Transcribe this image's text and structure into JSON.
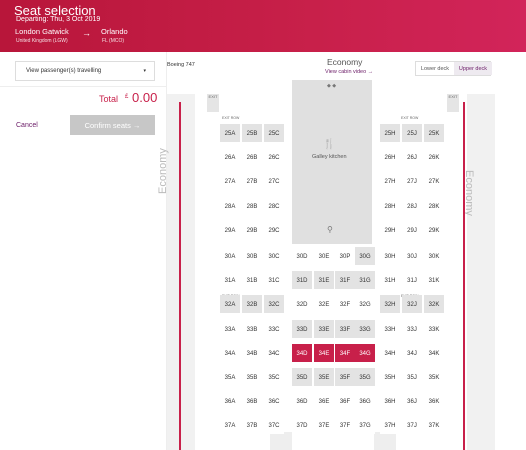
{
  "header": {
    "title": "Seat selection",
    "departing": "Departing: Thu, 3 Oct 2019",
    "from_city": "London Gatwick",
    "from_sub": "United Kingdom (LGW)",
    "to_city": "Orlando",
    "to_sub": "FL (MCO)",
    "arrow": "→"
  },
  "left": {
    "passenger_select": "View passenger(s) travelling",
    "caret": "▾",
    "total_label": "Total",
    "total_currency": "£",
    "total_value": "0.00",
    "cancel_label": "Cancel",
    "confirm_label": "Confirm seats →"
  },
  "right": {
    "aircraft": "Boeing 747",
    "cabin_title": "Economy",
    "cabin_link": "View cabin video →",
    "lower_deck": "Lower deck",
    "upper_deck": "Upper deck",
    "econ_side_left": "Economy",
    "econ_side_right": "Economy",
    "exit": "EXIT",
    "exit_row": "EXIT ROW",
    "galley_label": "Galley kitchen"
  },
  "colors": {
    "brand": "#c8204a",
    "link": "#6a1a66",
    "unavailable": "#e3e3e3"
  },
  "seats": [
    {
      "id": "25A",
      "s": "u"
    },
    {
      "id": "25B",
      "s": "u"
    },
    {
      "id": "25C",
      "s": "u"
    },
    {
      "id": "25H",
      "s": "u"
    },
    {
      "id": "25J",
      "s": "u"
    },
    {
      "id": "25K",
      "s": "u"
    },
    {
      "id": "26A",
      "s": "a"
    },
    {
      "id": "26B",
      "s": "a"
    },
    {
      "id": "26C",
      "s": "a"
    },
    {
      "id": "26H",
      "s": "a"
    },
    {
      "id": "26J",
      "s": "a"
    },
    {
      "id": "26K",
      "s": "a"
    },
    {
      "id": "27A",
      "s": "a"
    },
    {
      "id": "27B",
      "s": "a"
    },
    {
      "id": "27C",
      "s": "a"
    },
    {
      "id": "27H",
      "s": "a"
    },
    {
      "id": "27J",
      "s": "a"
    },
    {
      "id": "27K",
      "s": "a"
    },
    {
      "id": "28A",
      "s": "a"
    },
    {
      "id": "28B",
      "s": "a"
    },
    {
      "id": "28C",
      "s": "a"
    },
    {
      "id": "28H",
      "s": "a"
    },
    {
      "id": "28J",
      "s": "a"
    },
    {
      "id": "28K",
      "s": "a"
    },
    {
      "id": "29A",
      "s": "a"
    },
    {
      "id": "29B",
      "s": "a"
    },
    {
      "id": "29C",
      "s": "a"
    },
    {
      "id": "29H",
      "s": "a"
    },
    {
      "id": "29J",
      "s": "a"
    },
    {
      "id": "29K",
      "s": "a"
    },
    {
      "id": "30A",
      "s": "a"
    },
    {
      "id": "30B",
      "s": "a"
    },
    {
      "id": "30C",
      "s": "a"
    },
    {
      "id": "30D",
      "s": "a"
    },
    {
      "id": "30E",
      "s": "a"
    },
    {
      "id": "30P",
      "s": "a"
    },
    {
      "id": "30G",
      "s": "u"
    },
    {
      "id": "30H",
      "s": "a"
    },
    {
      "id": "30J",
      "s": "a"
    },
    {
      "id": "30K",
      "s": "a"
    },
    {
      "id": "31A",
      "s": "a"
    },
    {
      "id": "31B",
      "s": "a"
    },
    {
      "id": "31C",
      "s": "a"
    },
    {
      "id": "31D",
      "s": "u"
    },
    {
      "id": "31E",
      "s": "u"
    },
    {
      "id": "31F",
      "s": "u"
    },
    {
      "id": "31G",
      "s": "u"
    },
    {
      "id": "31H",
      "s": "a"
    },
    {
      "id": "31J",
      "s": "a"
    },
    {
      "id": "31K",
      "s": "a"
    },
    {
      "id": "32A",
      "s": "u"
    },
    {
      "id": "32B",
      "s": "u"
    },
    {
      "id": "32C",
      "s": "u"
    },
    {
      "id": "32D",
      "s": "a"
    },
    {
      "id": "32E",
      "s": "a"
    },
    {
      "id": "32F",
      "s": "a"
    },
    {
      "id": "32G",
      "s": "a"
    },
    {
      "id": "32H",
      "s": "u"
    },
    {
      "id": "32J",
      "s": "u"
    },
    {
      "id": "32K",
      "s": "u"
    },
    {
      "id": "33A",
      "s": "a"
    },
    {
      "id": "33B",
      "s": "a"
    },
    {
      "id": "33C",
      "s": "a"
    },
    {
      "id": "33D",
      "s": "u"
    },
    {
      "id": "33E",
      "s": "u"
    },
    {
      "id": "33F",
      "s": "u"
    },
    {
      "id": "33G",
      "s": "u"
    },
    {
      "id": "33H",
      "s": "a"
    },
    {
      "id": "33J",
      "s": "a"
    },
    {
      "id": "33K",
      "s": "a"
    },
    {
      "id": "34A",
      "s": "a"
    },
    {
      "id": "34B",
      "s": "a"
    },
    {
      "id": "34C",
      "s": "a"
    },
    {
      "id": "34D",
      "s": "x"
    },
    {
      "id": "34E",
      "s": "x"
    },
    {
      "id": "34F",
      "s": "x"
    },
    {
      "id": "34G",
      "s": "x"
    },
    {
      "id": "34H",
      "s": "a"
    },
    {
      "id": "34J",
      "s": "a"
    },
    {
      "id": "34K",
      "s": "a"
    },
    {
      "id": "35A",
      "s": "a"
    },
    {
      "id": "35B",
      "s": "a"
    },
    {
      "id": "35C",
      "s": "a"
    },
    {
      "id": "35D",
      "s": "u"
    },
    {
      "id": "35E",
      "s": "u"
    },
    {
      "id": "35F",
      "s": "u"
    },
    {
      "id": "35G",
      "s": "u"
    },
    {
      "id": "35H",
      "s": "a"
    },
    {
      "id": "35J",
      "s": "a"
    },
    {
      "id": "35K",
      "s": "a"
    },
    {
      "id": "36A",
      "s": "a"
    },
    {
      "id": "36B",
      "s": "a"
    },
    {
      "id": "36C",
      "s": "a"
    },
    {
      "id": "36D",
      "s": "a"
    },
    {
      "id": "36E",
      "s": "a"
    },
    {
      "id": "36F",
      "s": "a"
    },
    {
      "id": "36G",
      "s": "a"
    },
    {
      "id": "36H",
      "s": "a"
    },
    {
      "id": "36J",
      "s": "a"
    },
    {
      "id": "36K",
      "s": "a"
    },
    {
      "id": "37A",
      "s": "a"
    },
    {
      "id": "37B",
      "s": "a"
    },
    {
      "id": "37C",
      "s": "a"
    },
    {
      "id": "37D",
      "s": "a"
    },
    {
      "id": "37E",
      "s": "a"
    },
    {
      "id": "37F",
      "s": "a"
    },
    {
      "id": "37G",
      "s": "a"
    },
    {
      "id": "37H",
      "s": "a"
    },
    {
      "id": "37J",
      "s": "a"
    },
    {
      "id": "37K",
      "s": "a"
    }
  ]
}
